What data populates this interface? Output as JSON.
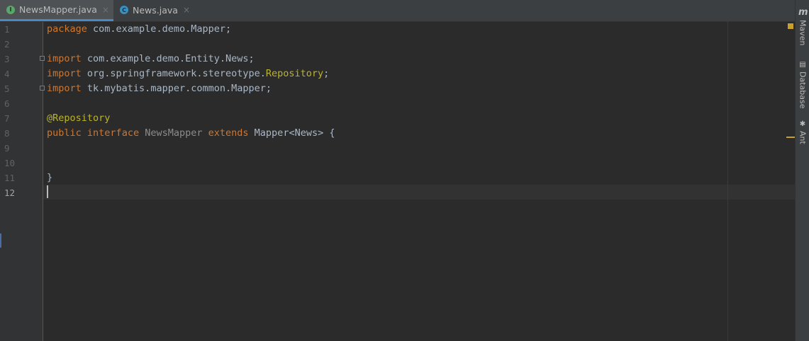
{
  "tabs": [
    {
      "label": "NewsMapper.java",
      "icon": "interface-icon",
      "icon_letter": "I",
      "icon_color": "#59a869",
      "active": true
    },
    {
      "label": "News.java",
      "icon": "class-icon",
      "icon_letter": "C",
      "icon_color": "#3592c4",
      "active": false
    }
  ],
  "close_glyph": "×",
  "line_numbers": [
    "1",
    "2",
    "3",
    "4",
    "5",
    "6",
    "7",
    "8",
    "9",
    "10",
    "11",
    "12"
  ],
  "current_line": "12",
  "code": {
    "l1": {
      "kw": "package",
      "rest": " com.example.demo.Mapper;"
    },
    "l3": {
      "kw": "import",
      "rest": " com.example.demo.Entity.News;"
    },
    "l4": {
      "kw": "import",
      "rest": " org.springframework.stereotype.",
      "cls": "Repository",
      "end": ";"
    },
    "l5": {
      "kw": "import",
      "rest": " tk.mybatis.mapper.common.Mapper;"
    },
    "l7": {
      "annotation": "@Repository"
    },
    "l8": {
      "kw1": "public",
      "kw2": "interface",
      "name": "NewsMapper",
      "kw3": "extends",
      "rest": " Mapper<News> {"
    },
    "l11": {
      "brace": "}"
    }
  },
  "tool_windows": [
    {
      "label": "Maven",
      "icon": "maven-icon"
    },
    {
      "label": "Database",
      "icon": "database-icon"
    },
    {
      "label": "Ant",
      "icon": "ant-icon"
    }
  ],
  "maven_logo": "m",
  "colors": {
    "keyword": "#cc7832",
    "annotation": "#bbb529",
    "text": "#a9b7c6",
    "background": "#2b2b2b"
  }
}
